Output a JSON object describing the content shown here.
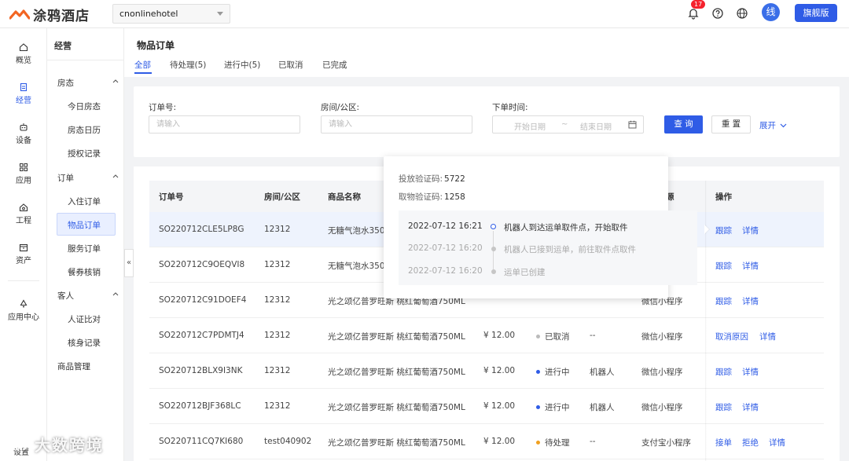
{
  "topbar": {
    "brand": "涂鸦酒店",
    "hotel_select": "cnonlinehotel",
    "notification_count": "17",
    "avatar_text": "线",
    "edition_button": "旗舰版",
    "accent": "#2f5ce6"
  },
  "rail": {
    "items": [
      {
        "label": "概览",
        "icon": "home-icon"
      },
      {
        "label": "经营",
        "icon": "document-icon",
        "active": true
      },
      {
        "label": "设备",
        "icon": "robot-icon"
      },
      {
        "label": "应用",
        "icon": "grid-icon"
      },
      {
        "label": "工程",
        "icon": "home-settings-icon"
      },
      {
        "label": "资产",
        "icon": "box-icon"
      },
      {
        "label": "应用中心",
        "icon": "recycle-icon"
      }
    ],
    "bottom": "设置"
  },
  "subnav": {
    "title": "经营",
    "groups": [
      {
        "label": "房态",
        "items": [
          "今日房态",
          "房态日历",
          "授权记录"
        ]
      },
      {
        "label": "订单",
        "items": [
          "入住订单",
          "物品订单",
          "服务订单",
          "餐券核销"
        ]
      },
      {
        "label": "客人",
        "items": [
          "人证比对",
          "核身记录"
        ]
      }
    ],
    "standalone": "商品管理",
    "active_item": "物品订单"
  },
  "main": {
    "title": "物品订单",
    "tabs": [
      "全部",
      "待处理(5)",
      "进行中(5)",
      "已取消",
      "已完成"
    ],
    "active_tab": "全部"
  },
  "filter": {
    "order_no_label": "订单号:",
    "order_no_placeholder": "请输入",
    "room_label": "房间/公区:",
    "room_placeholder": "请输入",
    "time_label": "下单时间:",
    "start_placeholder": "开始日期",
    "range_sep": "~",
    "end_placeholder": "结束日期",
    "search_button": "查 询",
    "reset_button": "重 置",
    "expand_link": "展开"
  },
  "table": {
    "headers": {
      "order_no": "订单号",
      "room": "房间/公区",
      "product": "商品名称",
      "source": "源",
      "ops": "操作"
    },
    "rows": [
      {
        "order_no": "SO220712CLE5LP8G",
        "room": "12312",
        "product": "无糖气泡水350",
        "price": "",
        "status": "",
        "status_color": "",
        "executor": "",
        "source": "",
        "actions": [
          "跟踪",
          "详情"
        ]
      },
      {
        "order_no": "SO220712C9OEQVI8",
        "room": "12312",
        "product": "无糖气泡水350",
        "price": "",
        "status": "",
        "status_color": "",
        "executor": "",
        "source": "",
        "actions": [
          "跟踪",
          "详情"
        ]
      },
      {
        "order_no": "SO220712C91DOEF4",
        "room": "12312",
        "product": "光之颂亿普罗旺斯 桃红葡萄酒750ML",
        "price": "",
        "status": "",
        "status_color": "",
        "executor": "",
        "source": "微信小程序",
        "actions": [
          "跟踪",
          "详情"
        ]
      },
      {
        "order_no": "SO220712C7PDMTJ4",
        "room": "12312",
        "product": "光之颂亿普罗旺斯 桃红葡萄酒750ML",
        "price": "¥ 12.00",
        "status": "已取消",
        "status_color": "#bbbbbb",
        "executor": "--",
        "source": "微信小程序",
        "actions": [
          "取消原因",
          "详情"
        ]
      },
      {
        "order_no": "SO220712BLX9I3NK",
        "room": "12312",
        "product": "光之颂亿普罗旺斯 桃红葡萄酒750ML",
        "price": "¥ 12.00",
        "status": "进行中",
        "status_color": "#2f5ce6",
        "executor": "机器人",
        "source": "微信小程序",
        "actions": [
          "跟踪",
          "详情"
        ]
      },
      {
        "order_no": "SO220712BJF368LC",
        "room": "12312",
        "product": "光之颂亿普罗旺斯 桃红葡萄酒750ML",
        "price": "¥ 12.00",
        "status": "进行中",
        "status_color": "#2f5ce6",
        "executor": "机器人",
        "source": "微信小程序",
        "actions": [
          "跟踪",
          "详情"
        ]
      },
      {
        "order_no": "SO220711CQ7KI680",
        "room": "test040902",
        "product": "光之颂亿普罗旺斯 桃红葡萄酒750ML",
        "price": "¥ 12.00",
        "status": "待处理",
        "status_color": "#f0a020",
        "executor": "--",
        "source": "支付宝小程序",
        "actions": [
          "接单",
          "拒绝",
          "详情"
        ]
      }
    ]
  },
  "popover": {
    "put_code_label": "投放验证码:",
    "put_code": "5722",
    "take_code_label": "取物验证码:",
    "take_code": "1258",
    "timeline": [
      {
        "time": "2022-07-12 16:21",
        "text": "机器人到达运单取件点，开始取件"
      },
      {
        "time": "2022-07-12 16:20",
        "text": "机器人已接到运单，前往取件点取件"
      },
      {
        "time": "2022-07-12 16:20",
        "text": "运单已创建"
      }
    ]
  },
  "watermark": "大数跨境"
}
